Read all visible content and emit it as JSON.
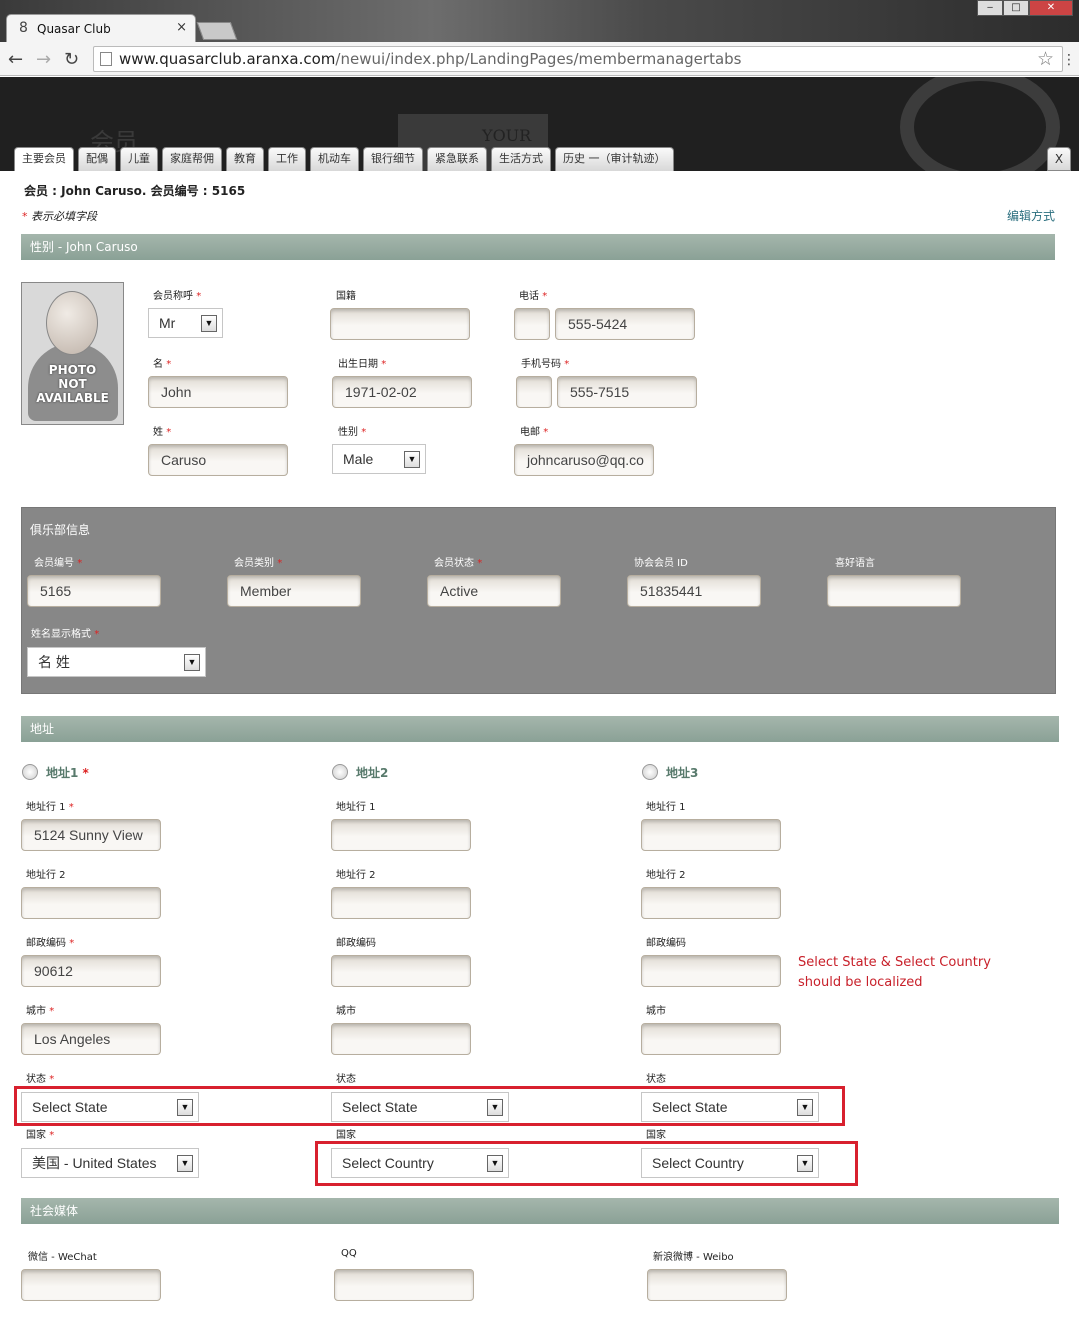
{
  "browser": {
    "tab_title": "Quasar Club",
    "tab_close": "×",
    "url_domain": "www.quasarclub.aranxa.com",
    "url_path": "/newui/index.php/LandingPages/membermanagertabs",
    "win_min": "‒",
    "win_max": "□",
    "win_close": "✕"
  },
  "header": {
    "ghost_title": "会员",
    "ghost_text": "YOUR",
    "tabs": [
      "主要会员",
      "配偶",
      "儿童",
      "家庭帮佣",
      "教育",
      "工作",
      "机动车",
      "银行细节",
      "紧急联系",
      "生活方式",
      "历史 一（审计轨迹）"
    ],
    "close_label": "X"
  },
  "page": {
    "member_title": "会员 : John Caruso. 会员编号 : 5165",
    "required_star": "*",
    "required_note": "表示必填字段",
    "edit_link": "编辑方式"
  },
  "personal": {
    "section_title": "性别 - John Caruso",
    "photo_text_1": "PHOTO",
    "photo_text_2": "NOT",
    "photo_text_3": "AVAILABLE",
    "salutation_label": "会员称呼",
    "salutation_value": "Mr",
    "nationality_label": "国籍",
    "nationality_value": "",
    "phone_label": "电话",
    "phone_prefix": "",
    "phone_value": "555-5424",
    "first_name_label": "名",
    "first_name_value": "John",
    "dob_label": "出生日期",
    "dob_value": "1971-02-02",
    "mobile_label": "手机号码",
    "mobile_prefix": "",
    "mobile_value": "555-7515",
    "last_name_label": "姓",
    "last_name_value": "Caruso",
    "gender_label": "性别",
    "gender_value": "Male",
    "email_label": "电邮",
    "email_value": "johncaruso@qq.co"
  },
  "club": {
    "title": "俱乐部信息",
    "member_no_label": "会员编号",
    "member_no_value": "5165",
    "member_type_label": "会员类别",
    "member_type_value": "Member",
    "member_status_label": "会员状态",
    "member_status_value": "Active",
    "assoc_id_label": "协会会员 ID",
    "assoc_id_value": "51835441",
    "language_label": "喜好语言",
    "language_value": "",
    "name_format_label": "姓名显示格式",
    "name_format_value": "名 姓"
  },
  "address": {
    "section_title": "地址",
    "columns": [
      {
        "heading": "地址1",
        "line1_label": "地址行 1",
        "line1_value": "5124 Sunny View",
        "line2_label": "地址行 2",
        "line2_value": "",
        "zip_label": "邮政编码",
        "zip_value": "90612",
        "city_label": "城市",
        "city_value": "Los Angeles",
        "state_label": "状态",
        "state_value": "Select State",
        "country_label": "国家",
        "country_value": "美国 - United States"
      },
      {
        "heading": "地址2",
        "line1_label": "地址行 1",
        "line1_value": "",
        "line2_label": "地址行 2",
        "line2_value": "",
        "zip_label": "邮政编码",
        "zip_value": "",
        "city_label": "城市",
        "city_value": "",
        "state_label": "状态",
        "state_value": "Select State",
        "country_label": "国家",
        "country_value": "Select Country"
      },
      {
        "heading": "地址3",
        "line1_label": "地址行 1",
        "line1_value": "",
        "line2_label": "地址行 2",
        "line2_value": "",
        "zip_label": "邮政编码",
        "zip_value": "",
        "city_label": "城市",
        "city_value": "",
        "state_label": "状态",
        "state_value": "Select State",
        "country_label": "国家",
        "country_value": "Select Country"
      }
    ],
    "annotation": "Select State & Select Country should be localized"
  },
  "social": {
    "section_title": "社会媒体",
    "wechat_label": "微信 - WeChat",
    "wechat_value": "",
    "qq_label": "QQ",
    "qq_value": "",
    "weibo_label": "新浪微博 - Weibo",
    "weibo_value": ""
  },
  "icons": {
    "back": "back-arrow-icon",
    "forward": "forward-arrow-icon",
    "reload": "reload-icon",
    "star": "bookmark-star-icon",
    "dropdown": "dropdown-arrow-icon"
  },
  "colors": {
    "section_bar": "#95aa9f",
    "club_panel": "#878787",
    "annotation_red": "#c8202a",
    "link": "#2a6e7e"
  }
}
